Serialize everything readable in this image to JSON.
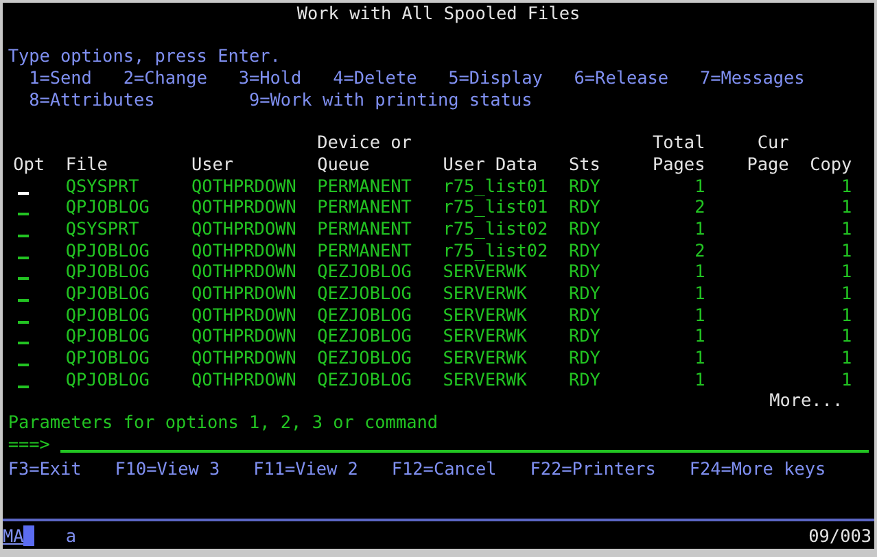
{
  "title": "Work with All Spooled Files",
  "instructions": "Type options, press Enter.",
  "options": [
    [
      "1=Send",
      "2=Change",
      "3=Hold",
      "4=Delete",
      "5=Display",
      "6=Release",
      "7=Messages"
    ],
    [
      "8=Attributes",
      "9=Work with printing status"
    ]
  ],
  "columns": [
    {
      "heading": [
        "Opt"
      ]
    },
    {
      "heading": [
        "File"
      ]
    },
    {
      "heading": [
        "User"
      ]
    },
    {
      "heading": [
        "Device or",
        "Queue"
      ]
    },
    {
      "heading": [
        "User Data"
      ]
    },
    {
      "heading": [
        "Sts"
      ]
    },
    {
      "heading": [
        "Total",
        "Pages"
      ]
    },
    {
      "heading": [
        "Cur",
        "Page"
      ]
    },
    {
      "heading": [
        "Copy"
      ]
    }
  ],
  "rows": [
    {
      "cursor": true,
      "file": "QSYSPRT",
      "user": "QOTHPRDOWN",
      "queue": "PERMANENT",
      "user_data": "r75_list01",
      "status": "RDY",
      "total_pages": "1",
      "copies": "1"
    },
    {
      "cursor": false,
      "file": "QPJOBLOG",
      "user": "QOTHPRDOWN",
      "queue": "PERMANENT",
      "user_data": "r75_list01",
      "status": "RDY",
      "total_pages": "2",
      "copies": "1"
    },
    {
      "cursor": false,
      "file": "QSYSPRT",
      "user": "QOTHPRDOWN",
      "queue": "PERMANENT",
      "user_data": "r75_list02",
      "status": "RDY",
      "total_pages": "1",
      "copies": "1"
    },
    {
      "cursor": false,
      "file": "QPJOBLOG",
      "user": "QOTHPRDOWN",
      "queue": "PERMANENT",
      "user_data": "r75_list02",
      "status": "RDY",
      "total_pages": "2",
      "copies": "1"
    },
    {
      "cursor": false,
      "file": "QPJOBLOG",
      "user": "QOTHPRDOWN",
      "queue": "QEZJOBLOG",
      "user_data": "SERVERWK",
      "status": "RDY",
      "total_pages": "1",
      "copies": "1"
    },
    {
      "cursor": false,
      "file": "QPJOBLOG",
      "user": "QOTHPRDOWN",
      "queue": "QEZJOBLOG",
      "user_data": "SERVERWK",
      "status": "RDY",
      "total_pages": "1",
      "copies": "1"
    },
    {
      "cursor": false,
      "file": "QPJOBLOG",
      "user": "QOTHPRDOWN",
      "queue": "QEZJOBLOG",
      "user_data": "SERVERWK",
      "status": "RDY",
      "total_pages": "1",
      "copies": "1"
    },
    {
      "cursor": false,
      "file": "QPJOBLOG",
      "user": "QOTHPRDOWN",
      "queue": "QEZJOBLOG",
      "user_data": "SERVERWK",
      "status": "RDY",
      "total_pages": "1",
      "copies": "1"
    },
    {
      "cursor": false,
      "file": "QPJOBLOG",
      "user": "QOTHPRDOWN",
      "queue": "QEZJOBLOG",
      "user_data": "SERVERWK",
      "status": "RDY",
      "total_pages": "1",
      "copies": "1"
    },
    {
      "cursor": false,
      "file": "QPJOBLOG",
      "user": "QOTHPRDOWN",
      "queue": "QEZJOBLOG",
      "user_data": "SERVERWK",
      "status": "RDY",
      "total_pages": "1",
      "copies": "1"
    }
  ],
  "more": "More...",
  "command": {
    "label": "Parameters for options 1, 2, 3 or command",
    "prompt": "===>"
  },
  "function_keys": [
    "F3=Exit",
    "F10=View 3",
    "F11=View 2",
    "F12=Cancel",
    "F22=Printers",
    "F24=More keys"
  ],
  "status_bar": {
    "mode": "MA",
    "indicator": "a",
    "position": "09/003"
  }
}
